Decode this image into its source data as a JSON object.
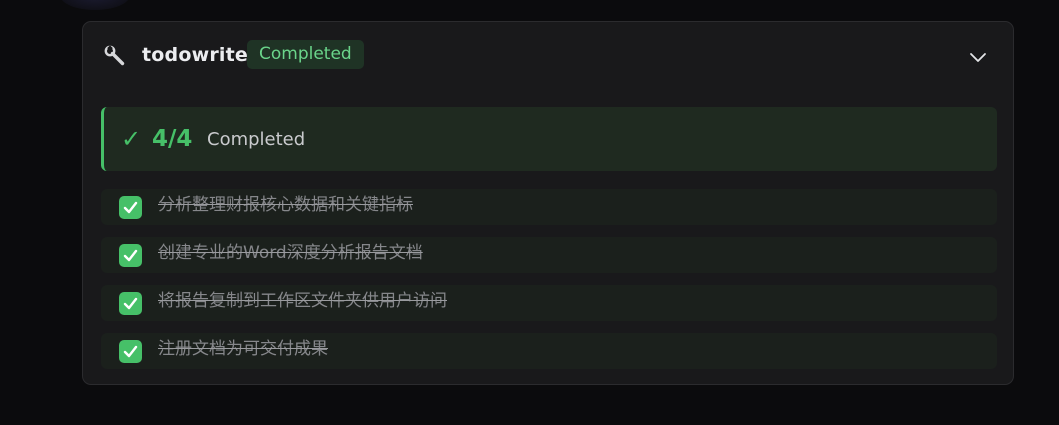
{
  "tool": {
    "name": "todowrite",
    "status": "Completed",
    "icon": "wrench-icon",
    "expand_icon": "chevron-down-icon"
  },
  "summary": {
    "check_glyph": "✓",
    "count": "4/4",
    "label": "Completed"
  },
  "todos": [
    {
      "text": "分析整理财报核心数据和关键指标",
      "done": true
    },
    {
      "text": "创建专业的Word深度分析报告文档",
      "done": true
    },
    {
      "text": "将报告复制到工作区文件夹供用户访问",
      "done": true
    },
    {
      "text": "注册文档为可交付成果",
      "done": true
    }
  ],
  "colors": {
    "background": "#0b0b0d",
    "card": "#19191b",
    "accent_green": "#46c068",
    "badge_bg": "#1f3325",
    "summary_bg": "#1f2a20"
  }
}
